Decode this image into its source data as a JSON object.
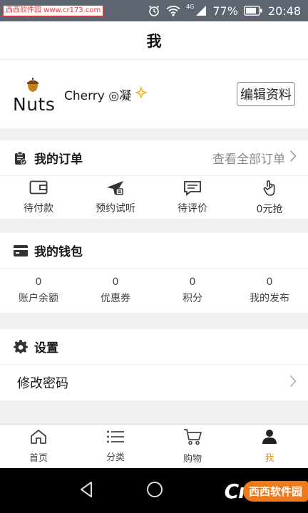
{
  "status_bar": {
    "watermark": "西西软件园 www.cr173.com",
    "network": "4G",
    "battery": "77%",
    "time": "20:48"
  },
  "header": {
    "title": "我"
  },
  "profile": {
    "logo_text": "Nuts",
    "username": "Cherry ◎凝",
    "edit_label": "编辑资料"
  },
  "orders": {
    "title": "我的订单",
    "view_all": "查看全部订单",
    "items": [
      {
        "label": "待付款",
        "icon": "wallet-icon"
      },
      {
        "label": "预约试听",
        "icon": "send-icon"
      },
      {
        "label": "待评价",
        "icon": "comment-icon"
      },
      {
        "label": "0元抢",
        "icon": "hand-tap-icon"
      }
    ]
  },
  "wallet": {
    "title": "我的钱包",
    "items": [
      {
        "value": "0",
        "label": "账户余额"
      },
      {
        "value": "0",
        "label": "优惠券"
      },
      {
        "value": "0",
        "label": "积分"
      },
      {
        "value": "0",
        "label": "我的发布"
      }
    ]
  },
  "settings": {
    "title": "设置",
    "items": [
      {
        "label": "修改密码"
      }
    ]
  },
  "tabs": [
    {
      "label": "首页",
      "icon": "home-icon",
      "active": false
    },
    {
      "label": "分类",
      "icon": "list-icon",
      "active": false
    },
    {
      "label": "购物",
      "icon": "cart-icon",
      "active": false
    },
    {
      "label": "我",
      "icon": "user-icon",
      "active": true
    }
  ],
  "nav_brand": {
    "logo": "Cr",
    "tag": "西西软件园"
  },
  "colors": {
    "accent": "#e8a21a",
    "status_bar": "#5d6670",
    "brand_orange": "#f07a1a"
  }
}
